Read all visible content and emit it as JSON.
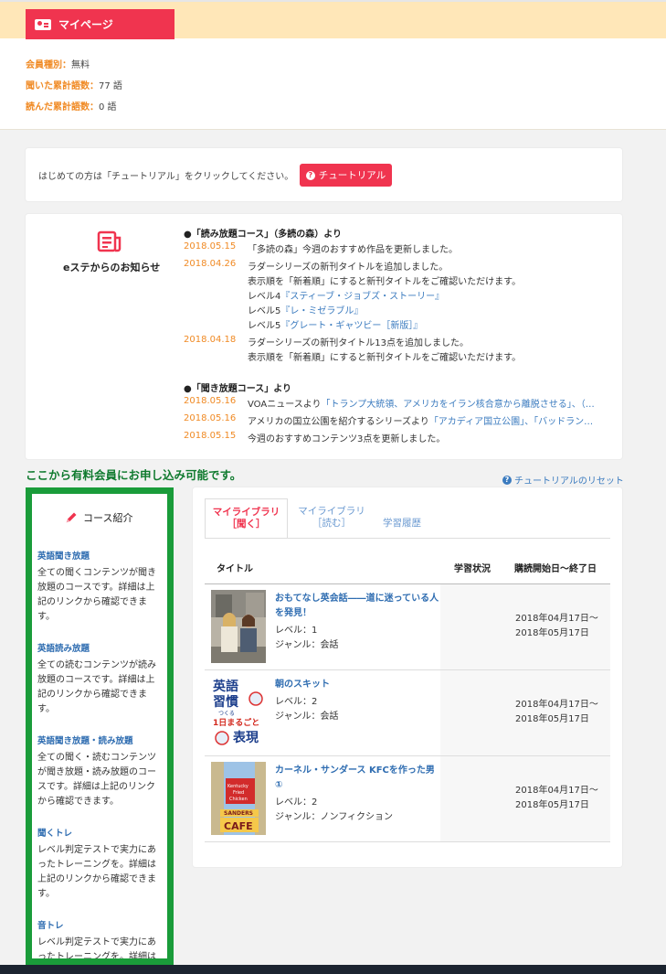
{
  "mypage": {
    "tab_label": "マイページ",
    "rows": [
      {
        "key": "会員種別：",
        "value": "無料"
      },
      {
        "key": "聞いた累計語数：",
        "value": "77 語"
      },
      {
        "key": "読んだ累計語数：",
        "value": "0 語"
      }
    ]
  },
  "tutorial": {
    "text": "はじめての方は「チュートリアル」をクリックしてください。",
    "button": "チュートリアル",
    "reset": "チュートリアルのリセット"
  },
  "news": {
    "heading": "eステからのお知らせ",
    "section1": "●「読み放題コース」（多読の森）より",
    "section2": "●「聞き放題コース」より",
    "items1": [
      {
        "date": "2018.05.15",
        "lines": [
          "「多読の森」今週のおすすめ作品を更新しました。"
        ]
      },
      {
        "date": "2018.04.26",
        "lines": [
          "ラダーシリーズの新刊タイトルを追加しました。",
          "表示順を「新着順」にすると新刊タイトルをご確認いただけます。"
        ],
        "links": [
          {
            "prefix": "レベル4",
            "title": "『スティーブ・ジョブズ・ストーリー』"
          },
          {
            "prefix": "レベル5",
            "title": "『レ・ミゼラブル』"
          },
          {
            "prefix": "レベル5",
            "title": "『グレート・ギャツビー［新版］』"
          }
        ]
      },
      {
        "date": "2018.04.18",
        "lines": [
          "ラダーシリーズの新刊タイトル13点を追加しました。",
          "表示順を「新着順」にすると新刊タイトルをご確認いただけます。"
        ]
      }
    ],
    "items2": [
      {
        "date": "2018.05.16",
        "pre": "VOAニュースより",
        "link": "「トランプ大統領、アメリカをイラン核合意から離脱させる」、（…"
      },
      {
        "date": "2018.05.16",
        "pre": "アメリカの国立公園を紹介するシリーズより",
        "link": "「アカディア国立公園」、「バッドラン…"
      },
      {
        "date": "2018.05.15",
        "pre": "今週のおすすめコンテンツ3点を更新しました。",
        "link": ""
      }
    ]
  },
  "paid_notice": "ここから有料会員にお申し込み可能です。",
  "course": {
    "title": "コース紹介",
    "items": [
      {
        "title": "英語聞き放題",
        "desc": "全ての聞くコンテンツが聞き放題のコースです。詳細は上記のリンクから確認できます。"
      },
      {
        "title": "英語読み放題",
        "desc": "全ての読むコンテンツが読み放題のコースです。詳細は上記のリンクから確認できます。"
      },
      {
        "title": "英語聞き放題・読み放題",
        "desc": "全ての聞く・読むコンテンツが聞き放題・読み放題のコースです。詳細は上記のリンクから確認できます。"
      },
      {
        "title": "聞くトレ",
        "desc": "レベル判定テストで実力にあったトレーニングを。詳細は上記のリンクから確認できます。"
      },
      {
        "title": "音トレ",
        "desc": "レベル判定テストで実力にあったトレーニングを。詳細は"
      }
    ]
  },
  "library": {
    "tabs": [
      {
        "line1": "マイライブラリ",
        "line2": "［聞く］"
      },
      {
        "line1": "マイライブラリ",
        "line2": "［読む］"
      },
      {
        "line1": "学習履歴",
        "line2": ""
      }
    ],
    "headers": {
      "title": "タイトル",
      "status": "学習状況",
      "period": "購読開始日～終了日"
    },
    "rows": [
      {
        "title": "おもてなし英会話――道に迷っている人を発見！",
        "level": "レベル：1",
        "genre": "ジャンル：会話",
        "start": "2018年04月17日～",
        "end": "2018年05月17日",
        "thumb": "photo-women"
      },
      {
        "title": "朝のスキット",
        "level": "レベル：2",
        "genre": "ジャンル：会話",
        "start": "2018年04月17日～",
        "end": "2018年05月17日",
        "thumb": "book-cover",
        "cover": {
          "l1": "英語",
          "l2": "習慣",
          "l3": "つくる",
          "l4": "1日まるごと",
          "l5": "表現"
        }
      },
      {
        "title": "カーネル・サンダース KFCを作った男 ①",
        "level": "レベル：2",
        "genre": "ジャンル：ノンフィクション",
        "start": "2018年04月17日～",
        "end": "2018年05月17日",
        "thumb": "photo-kfc",
        "sign": {
          "k1": "Kentucky",
          "k2": "Fried",
          "k3": "Chicken",
          "s1": "SANDERS",
          "s2": "CAFE"
        }
      }
    ]
  }
}
